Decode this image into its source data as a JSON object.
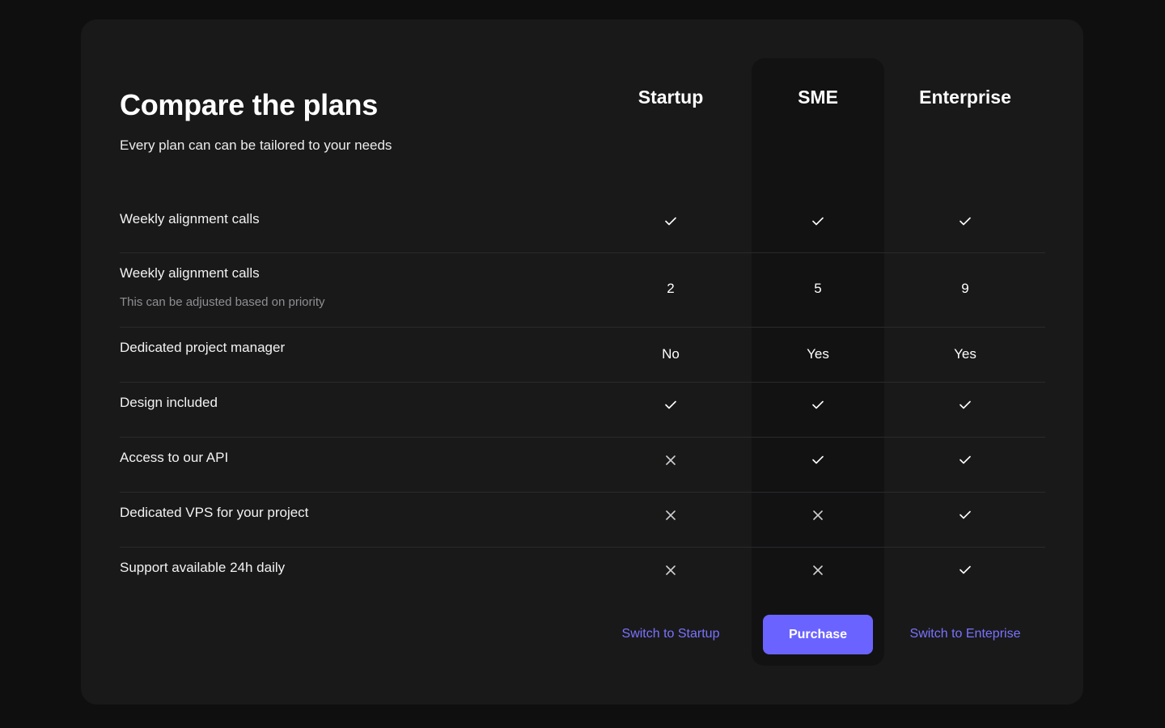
{
  "header": {
    "title": "Compare the plans",
    "subtitle": "Every plan can can be tailored to your needs"
  },
  "plans": [
    "Startup",
    "SME",
    "Enterprise"
  ],
  "rows": [
    {
      "label": "Weekly alignment calls",
      "note": "",
      "values": [
        "check",
        "check",
        "check"
      ]
    },
    {
      "label": "Weekly alignment calls",
      "note": "This can be adjusted based on priority",
      "values": [
        "2",
        "5",
        "9"
      ]
    },
    {
      "label": "Dedicated project manager",
      "note": "",
      "values": [
        "No",
        "Yes",
        "Yes"
      ]
    },
    {
      "label": "Design included",
      "note": "",
      "values": [
        "check",
        "check",
        "check"
      ]
    },
    {
      "label": "Access to our API",
      "note": "",
      "values": [
        "cross",
        "check",
        "check"
      ]
    },
    {
      "label": "Dedicated VPS for your project",
      "note": "",
      "values": [
        "cross",
        "cross",
        "check"
      ]
    },
    {
      "label": "Support available 24h daily",
      "note": "",
      "values": [
        "cross",
        "cross",
        "check"
      ]
    }
  ],
  "actions": {
    "startup": "Switch to Startup",
    "sme": "Purchase",
    "enterprise": "Switch to Enteprise"
  },
  "colors": {
    "accent": "#6b63ff",
    "link": "#7a73ff",
    "background": "#0f0f10",
    "card": "#19191a",
    "highlight_column": "#121213"
  },
  "icons": {
    "check": "check-icon",
    "cross": "cross-icon"
  }
}
